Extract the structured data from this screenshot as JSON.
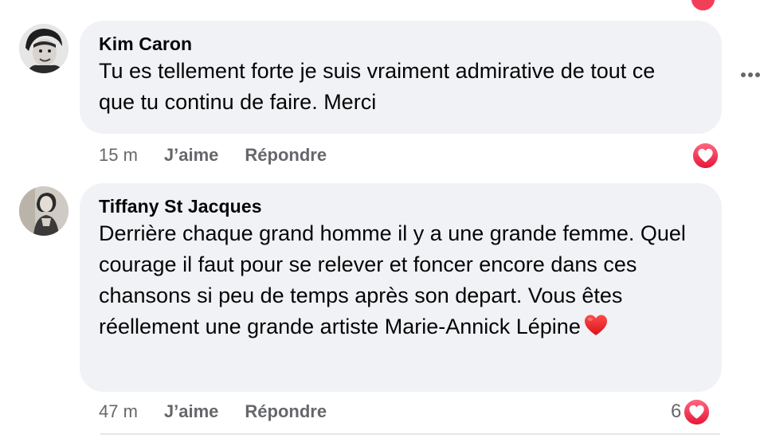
{
  "colors": {
    "bubble_bg": "#f0f2f5",
    "meta_text": "#65676b",
    "love_red": "#f33e58",
    "text": "#050505"
  },
  "icons": {
    "love_reaction": "love-reaction-icon",
    "heart_emoji": "red-heart-emoji-icon",
    "more_options": "more-horizontal-icon"
  },
  "comments": [
    {
      "author": "Kim Caron",
      "text": "Tu es tellement forte je suis vraiment admirative de tout ce que tu continu de faire. Merci",
      "time": "15 m",
      "like_label": "J’aime",
      "reply_label": "Répondre",
      "reaction_count": ""
    },
    {
      "author": "Tiffany St Jacques",
      "text": "Derrière chaque grand homme il y a une grande femme. Quel courage il faut pour se relever et foncer encore dans ces chansons si peu de temps après son depart. Vous êtes réellement une grande artiste Marie-Annick Lépine",
      "time": "47 m",
      "like_label": "J’aime",
      "reply_label": "Répondre",
      "reaction_count": "6"
    }
  ]
}
